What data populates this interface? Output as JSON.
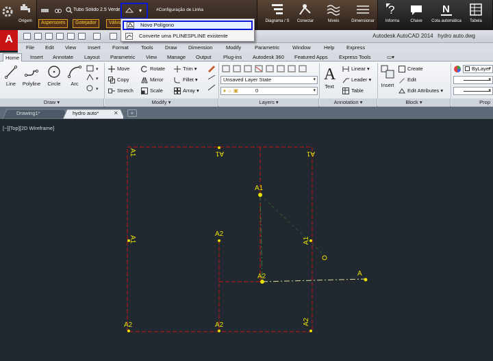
{
  "plugin_toolbar": {
    "origem_label": "Origem",
    "pipe_label": "Tubo Sólido 2.5 Verde",
    "line_config_label": "#Configuração de Linha",
    "tags": [
      "Aspersores",
      "Gotejador",
      "Válvu"
    ],
    "buttons": [
      {
        "label": "Diagrama / S",
        "icon": "diagram-icon"
      },
      {
        "label": "Conectar",
        "icon": "connect-icon"
      },
      {
        "label": "Níveis",
        "icon": "levels-icon"
      },
      {
        "label": "Dimensionar",
        "icon": "dimension-icon"
      },
      {
        "label": "Informa",
        "icon": "info-icon"
      },
      {
        "label": "Chave",
        "icon": "key-icon"
      },
      {
        "label": "Cota automática",
        "icon": "auto-dimension-icon"
      },
      {
        "label": "Tabela",
        "icon": "table-icon"
      }
    ]
  },
  "dropdown": {
    "items": [
      "Novo Polígono",
      "Converte uma PLINESPLINE existente"
    ]
  },
  "title_bar": {
    "app_title": "Autodesk AutoCAD 2014",
    "file_name": "hydro auto.dwg"
  },
  "menu": [
    "File",
    "Edit",
    "View",
    "Insert",
    "Format",
    "Tools",
    "Draw",
    "Dimension",
    "Modify",
    "Parametric",
    "Window",
    "Help",
    "Express"
  ],
  "ribbon_tabs": [
    "Home",
    "Insert",
    "Annotate",
    "Layout",
    "Parametric",
    "View",
    "Manage",
    "Output",
    "Plug-ins",
    "Autodesk 360",
    "Featured Apps",
    "Express Tools"
  ],
  "ribbon": {
    "draw": {
      "title": "Draw",
      "tools": [
        "Line",
        "Polyline",
        "Circle",
        "Arc"
      ]
    },
    "modify": {
      "title": "Modify",
      "tools": [
        "Move",
        "Rotate",
        "Trim",
        "Copy",
        "Mirror",
        "Fillet",
        "Stretch",
        "Scale",
        "Array"
      ]
    },
    "layers": {
      "title": "Layers",
      "layer_state": "Unsaved Layer State",
      "current_layer": "0"
    },
    "annotation": {
      "title": "Annotation",
      "text": "Text",
      "linear": "Linear",
      "leader": "Leader",
      "table": "Table"
    },
    "block": {
      "title": "Block",
      "insert": "Insert",
      "create": "Create",
      "edit": "Edit",
      "edit_attributes": "Edit Attributes"
    },
    "properties": {
      "title": "Prop",
      "color": "ByLayer"
    }
  },
  "file_tabs": [
    "Drawing1*",
    "hydro auto*"
  ],
  "viewport": {
    "label": "[−][Top][2D Wireframe]",
    "labels": [
      "A1",
      "A1",
      "A1",
      "A1",
      "A1",
      "A2",
      "A2",
      "A2",
      "A2",
      "A2",
      "A"
    ]
  },
  "colors": {
    "highlight": "#0a16d8",
    "canvas": "#212830",
    "boundary": "#c81414",
    "labels": "#e8e000",
    "app_red": "#c81414"
  }
}
